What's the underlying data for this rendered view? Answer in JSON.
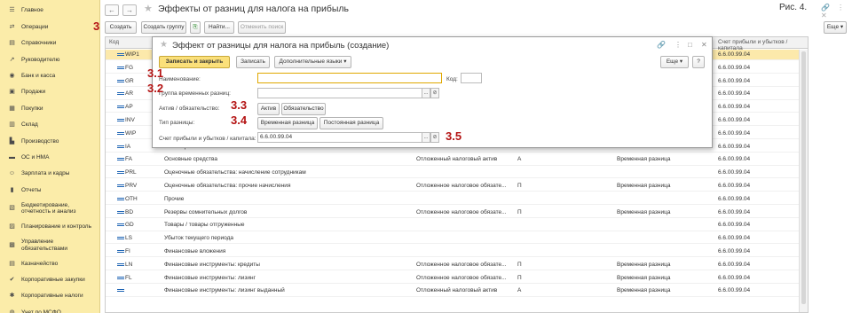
{
  "sidebar": {
    "items": [
      {
        "label": "Главное",
        "icon": "menu-icon"
      },
      {
        "label": "Операции",
        "icon": "operations-icon"
      },
      {
        "label": "Справочники",
        "icon": "book-icon"
      },
      {
        "label": "Руководителю",
        "icon": "chart-icon"
      },
      {
        "label": "Банк и касса",
        "icon": "bank-icon"
      },
      {
        "label": "Продажи",
        "icon": "cart-icon"
      },
      {
        "label": "Покупки",
        "icon": "bag-icon"
      },
      {
        "label": "Склад",
        "icon": "warehouse-icon"
      },
      {
        "label": "Производство",
        "icon": "factory-icon"
      },
      {
        "label": "ОС и НМА",
        "icon": "car-icon"
      },
      {
        "label": "Зарплата и кадры",
        "icon": "people-icon"
      },
      {
        "label": "Отчеты",
        "icon": "report-icon"
      },
      {
        "label": "Бюджетирование, отчетность и анализ",
        "icon": "budget-icon"
      },
      {
        "label": "Планирование и контроль",
        "icon": "plan-icon"
      },
      {
        "label": "Управление обязательствами",
        "icon": "liability-icon"
      },
      {
        "label": "Казначейство",
        "icon": "treasury-icon"
      },
      {
        "label": "Корпоративные закупки",
        "icon": "purchase-icon"
      },
      {
        "label": "Корпоративные налоги",
        "icon": "tax-icon"
      },
      {
        "label": "Учет по МСФО",
        "icon": "ifrs-icon"
      }
    ]
  },
  "header": {
    "back": "←",
    "forward": "→",
    "star": "★",
    "title": "Эффекты от разниц для налога на прибыль",
    "figure": "Рис. 4.",
    "links": "🔗 ⋮ ✕"
  },
  "toolbar": {
    "create": "Создать",
    "create_group": "Создать группу",
    "find": "Найти...",
    "cancel_search": "Отменить поиск",
    "more": "Еще ▾",
    "copy_icon": "⎘"
  },
  "table": {
    "col_code": "Код",
    "col_account": "Счет прибыли и убытков / капитала",
    "rows": [
      {
        "code": "WIP1",
        "name": "",
        "type": "",
        "sign": "",
        "diff": "",
        "account": "6.6.00.99.04"
      },
      {
        "code": "FG",
        "name": "",
        "type": "",
        "sign": "",
        "diff": "",
        "account": "6.6.00.99.04"
      },
      {
        "code": "GR",
        "name": "",
        "type": "",
        "sign": "",
        "diff": "",
        "account": "6.6.00.99.04"
      },
      {
        "code": "AR",
        "name": "",
        "type": "",
        "sign": "",
        "diff": "",
        "account": "6.6.00.99.04"
      },
      {
        "code": "AP",
        "name": "",
        "type": "",
        "sign": "",
        "diff": "",
        "account": "6.6.00.99.04"
      },
      {
        "code": "INV",
        "name": "",
        "type": "",
        "sign": "",
        "diff": "",
        "account": "6.6.00.99.04"
      },
      {
        "code": "WIP",
        "name": "",
        "type": "",
        "sign": "",
        "diff": "",
        "account": "6.6.00.99.04"
      },
      {
        "code": "IA",
        "name": "Нематериальные активы",
        "type": "",
        "sign": "",
        "diff": "",
        "account": "6.6.00.99.04"
      },
      {
        "code": "FA",
        "name": "Основные средства",
        "type": "Отложенный налоговый актив",
        "sign": "А",
        "diff": "Временная разница",
        "account": "6.6.00.99.04"
      },
      {
        "code": "PRL",
        "name": "Оценочные обязательства: начисление сотрудникам",
        "type": "",
        "sign": "",
        "diff": "",
        "account": "6.6.00.99.04"
      },
      {
        "code": "PRV",
        "name": "Оценочные обязательства: прочие начисления",
        "type": "Отложенное налоговое обязате...",
        "sign": "П",
        "diff": "Временная разница",
        "account": "6.6.00.99.04"
      },
      {
        "code": "OTH",
        "name": "Прочие",
        "type": "",
        "sign": "",
        "diff": "",
        "account": "6.6.00.99.04"
      },
      {
        "code": "BD",
        "name": "Резервы сомнительных долгов",
        "type": "Отложенное налоговое обязате...",
        "sign": "П",
        "diff": "Временная разница",
        "account": "6.6.00.99.04"
      },
      {
        "code": "GD",
        "name": "Товары / товары отгруженные",
        "type": "",
        "sign": "",
        "diff": "",
        "account": "6.6.00.99.04"
      },
      {
        "code": "LS",
        "name": "Убыток текущего периода",
        "type": "",
        "sign": "",
        "diff": "",
        "account": "6.6.00.99.04"
      },
      {
        "code": "FI",
        "name": "Финансовые вложения",
        "type": "",
        "sign": "",
        "diff": "",
        "account": "6.6.00.99.04"
      },
      {
        "code": "LN",
        "name": "Финансовые инструменты: кредиты",
        "type": "Отложенное налоговое обязате...",
        "sign": "П",
        "diff": "Временная разница",
        "account": "6.6.00.99.04"
      },
      {
        "code": "FL",
        "name": "Финансовые инструменты: лизинг",
        "type": "Отложенное налоговое обязате...",
        "sign": "П",
        "diff": "Временная разница",
        "account": "6.6.00.99.04"
      },
      {
        "code": "",
        "name": "Финансовые инструменты: лизинг выданный",
        "type": "Отложенный налоговый актив",
        "sign": "А",
        "diff": "Временная разница",
        "account": "6.6.00.99.04"
      }
    ]
  },
  "modal": {
    "title": "Эффект от разницы для налога на прибыль (создание)",
    "icons": {
      "link": "🔗",
      "menu": "⋮",
      "max": "□",
      "close": "✕"
    },
    "save_close": "Записать и закрыть",
    "save": "Записать",
    "languages": "Дополнительные языки ▾",
    "more": "Еще ▾",
    "help": "?",
    "name_label": "Наименование:",
    "name_value": "",
    "code_label": "Код:",
    "code_value": "",
    "group_label": "Группа временных разниц:",
    "group_value": "",
    "asset_label": "Актив / обязательство:",
    "asset_btn": "Актив",
    "liability_btn": "Обязательство",
    "diff_label": "Тип разницы:",
    "temp_btn": "Временная разница",
    "perm_btn": "Постоянная разница",
    "account_label": "Счет прибыли и убытков / капитала:",
    "account_value": "6.6.00.99.04",
    "select_glyph": "...",
    "link_glyph": "⊘"
  },
  "annotations": {
    "a3": "3",
    "a31": "3.1",
    "a32": "3.2",
    "a33": "3.3",
    "a34": "3.4",
    "a35": "3.5"
  },
  "colors": {
    "sidebar": "#fbeca9",
    "selected_row": "#fce9ab",
    "primary_button": "#fbe07a",
    "annotation": "#b41414"
  }
}
